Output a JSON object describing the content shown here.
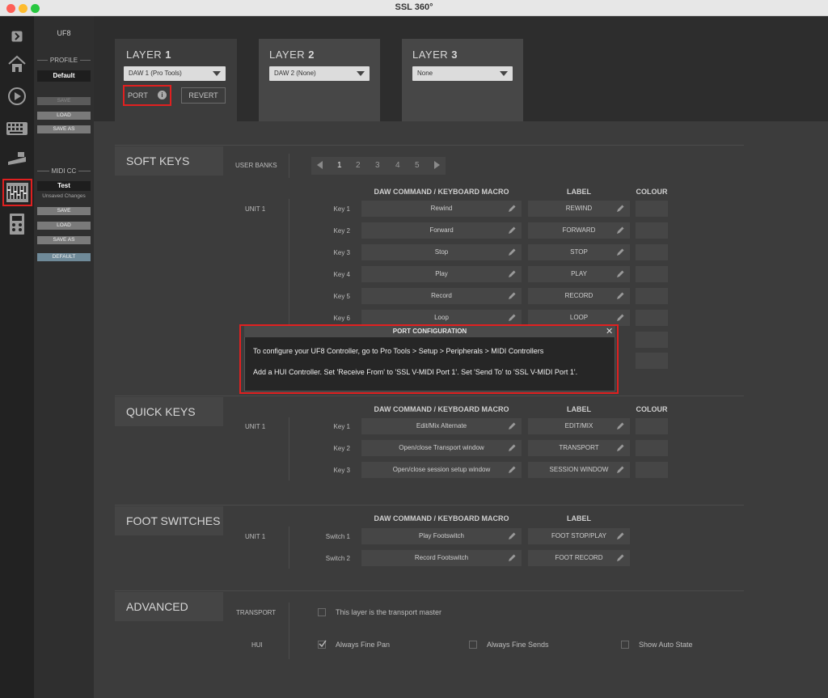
{
  "window": {
    "title": "SSL 360°"
  },
  "rail": {
    "icons": [
      "expand-icon",
      "home-icon",
      "plugin-icon",
      "keyboard-icon",
      "controller-icon",
      "uf8-mixer-icon",
      "uc1-icon"
    ]
  },
  "profile_panel": {
    "device": "UF8",
    "profile_label": "PROFILE",
    "profile_name": "Default",
    "save": "SAVE",
    "load": "LOAD",
    "save_as": "SAVE AS",
    "midi_label": "MIDI CC",
    "midi_name": "Test",
    "midi_status": "Unsaved Changes",
    "midi_save": "SAVE",
    "midi_load": "LOAD",
    "midi_save_as": "SAVE AS",
    "default": "DEFAULT"
  },
  "layers": [
    {
      "label": "LAYER",
      "num": "1",
      "daw": "DAW 1 (Pro Tools)"
    },
    {
      "label": "LAYER",
      "num": "2",
      "daw": "DAW 2 (None)"
    },
    {
      "label": "LAYER",
      "num": "3",
      "daw": "None"
    }
  ],
  "layer_buttons": {
    "port": "PORT",
    "revert": "REVERT"
  },
  "soft_keys": {
    "title": "SOFT KEYS",
    "user_banks": "USER BANKS",
    "banks": [
      "1",
      "2",
      "3",
      "4",
      "5"
    ],
    "col_command": "DAW COMMAND / KEYBOARD MACRO",
    "col_label": "LABEL",
    "col_colour": "COLOUR",
    "unit": "UNIT 1",
    "rows": [
      {
        "key": "Key 1",
        "command": "Rewind",
        "label": "REWIND"
      },
      {
        "key": "Key 2",
        "command": "Forward",
        "label": "FORWARD"
      },
      {
        "key": "Key 3",
        "command": "Stop",
        "label": "STOP"
      },
      {
        "key": "Key 4",
        "command": "Play",
        "label": "PLAY"
      },
      {
        "key": "Key 5",
        "command": "Record",
        "label": "RECORD"
      },
      {
        "key": "Key 6",
        "command": "Loop",
        "label": "LOOP"
      }
    ]
  },
  "modal": {
    "title": "PORT CONFIGURATION",
    "line1": "To configure your UF8 Controller, go to Pro Tools > Setup > Peripherals > MIDI Controllers",
    "line2": "Add a HUI Controller. Set 'Receive From' to 'SSL V-MIDI Port 1'. Set 'Send To' to 'SSL V-MIDI Port 1'."
  },
  "quick_keys": {
    "title": "QUICK KEYS",
    "col_command": "DAW COMMAND / KEYBOARD MACRO",
    "col_label": "LABEL",
    "col_colour": "COLOUR",
    "unit": "UNIT 1",
    "rows": [
      {
        "key": "Key 1",
        "command": "Edit/Mix Alternate",
        "label": "EDIT/MIX"
      },
      {
        "key": "Key 2",
        "command": "Open/close Transport window",
        "label": "TRANSPORT"
      },
      {
        "key": "Key 3",
        "command": "Open/close session setup window",
        "label": "SESSION WINDOW"
      }
    ]
  },
  "foot_switches": {
    "title": "FOOT SWITCHES",
    "col_command": "DAW COMMAND / KEYBOARD MACRO",
    "col_label": "LABEL",
    "unit": "UNIT 1",
    "rows": [
      {
        "key": "Switch 1",
        "command": "Play Footswitch",
        "label": "FOOT STOP/PLAY"
      },
      {
        "key": "Switch 2",
        "command": "Record Footswitch",
        "label": "FOOT RECORD"
      }
    ]
  },
  "advanced": {
    "title": "ADVANCED",
    "transport_label": "TRANSPORT",
    "transport_master": "This layer is the transport master",
    "hui_label": "HUI",
    "fine_pan": "Always Fine Pan",
    "fine_sends": "Always Fine Sends",
    "auto_state": "Show Auto State"
  },
  "colors": {
    "highlight": "#e02020",
    "accent_blue": "#6f8a99"
  }
}
